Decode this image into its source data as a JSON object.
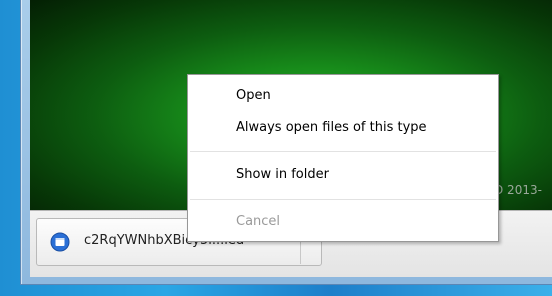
{
  "context_menu": {
    "open_label": "Open",
    "always_open_label": "Always open files of this type",
    "show_in_folder_label": "Show in folder",
    "cancel_label": "Cancel"
  },
  "download_shelf": {
    "file_name": "c2RqYWNhbXBicy5l...ied"
  },
  "page": {
    "copyright_text": "D 2013-"
  },
  "icons": {
    "download_file_icon": "chrome-file-icon"
  },
  "colors": {
    "menu_background": "#ffffff",
    "disabled_text": "#9a9a9a",
    "file_icon": "#2a6fd6"
  }
}
